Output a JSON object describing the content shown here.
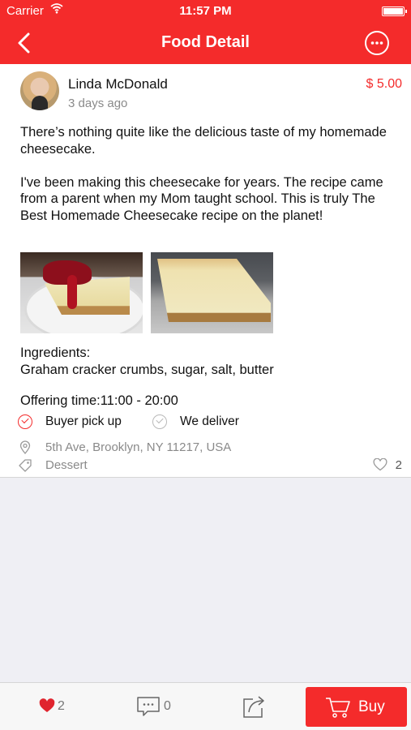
{
  "status_bar": {
    "carrier": "Carrier",
    "time": "11:57 PM"
  },
  "nav": {
    "title": "Food Detail",
    "back_icon": "chevron-left-icon",
    "more_icon": "ellipsis-circle-icon"
  },
  "post": {
    "author": "Linda McDonald",
    "posted": "3 days ago",
    "price": "$ 5.00",
    "description": [
      "There’s nothing quite like the delicious taste of my homemade cheesecake.",
      "I've been making this cheesecake for years. The recipe came from a parent when my Mom taught school. This is truly The Best Homemade Cheesecake recipe on the planet!"
    ],
    "ingredients_label": "Ingredients:",
    "ingredients": "Graham cracker crumbs, sugar, salt, butter",
    "offering_time": "Offering time:11:00 - 20:00",
    "options": [
      {
        "label": "Buyer pick up",
        "selected": true
      },
      {
        "label": "We deliver",
        "selected": false
      }
    ],
    "address": "5th Ave, Brooklyn, NY 11217, USA",
    "category": "Dessert",
    "likes": "2"
  },
  "colors": {
    "accent": "#f42b2b",
    "muted": "#8a8a8a",
    "background": "#efeff4"
  },
  "tab_bar": {
    "like_count": "2",
    "comment_count": "0",
    "buy_label": "Buy"
  }
}
